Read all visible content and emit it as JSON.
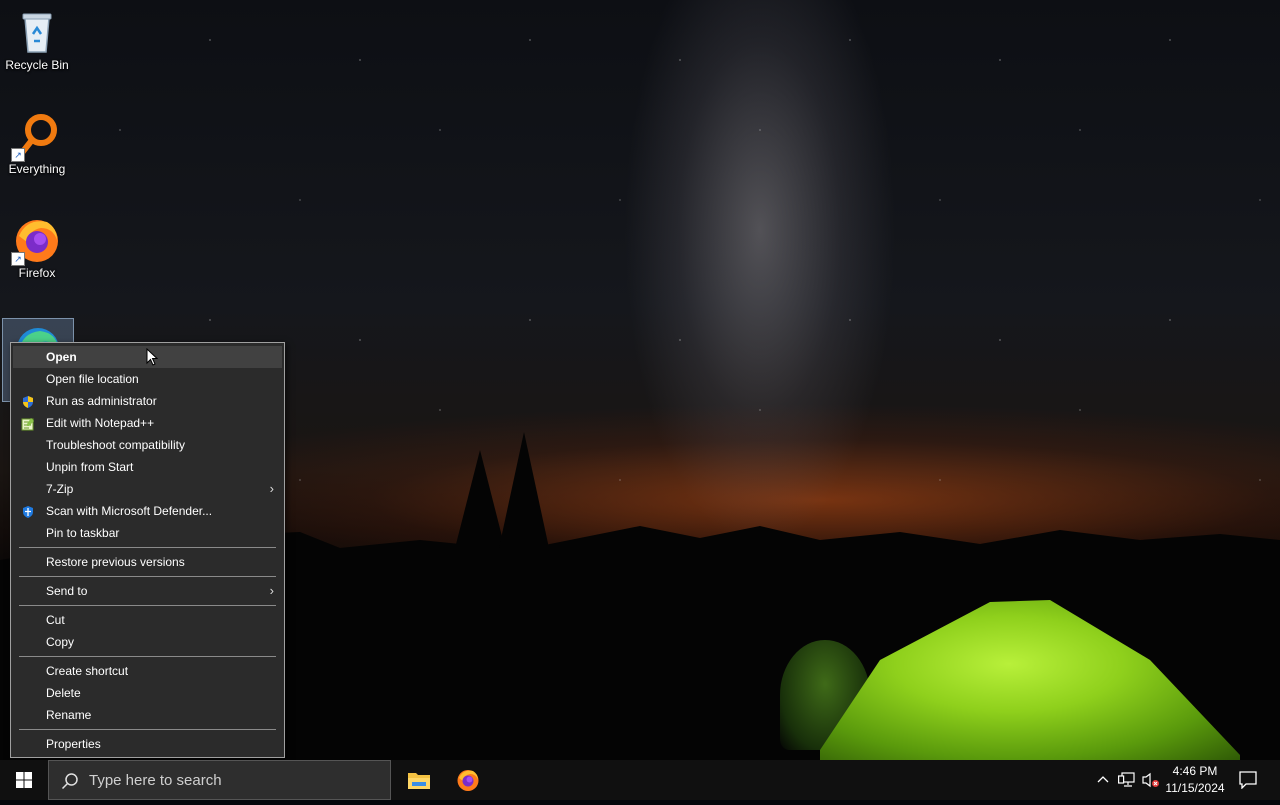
{
  "desktop": {
    "icons": [
      {
        "label": "Recycle Bin",
        "icon": "recycle-bin-icon"
      },
      {
        "label": "Everything",
        "icon": "everything-search-icon"
      },
      {
        "label": "Firefox",
        "icon": "firefox-icon"
      },
      {
        "label": "",
        "icon": "edge-icon"
      }
    ]
  },
  "context_menu": {
    "items": [
      {
        "label": "Open",
        "bold": true
      },
      {
        "label": "Open file location"
      },
      {
        "label": "Run as administrator",
        "icon": "uac-shield-icon"
      },
      {
        "label": "Edit with Notepad++",
        "icon": "notepadpp-icon"
      },
      {
        "label": "Troubleshoot compatibility"
      },
      {
        "label": "Unpin from Start"
      },
      {
        "label": "7-Zip",
        "submenu": true
      },
      {
        "label": "Scan with Microsoft Defender...",
        "icon": "defender-icon"
      },
      {
        "label": "Pin to taskbar"
      },
      {
        "label": "Restore previous versions"
      },
      {
        "label": "Send to",
        "submenu": true
      },
      {
        "label": "Cut"
      },
      {
        "label": "Copy"
      },
      {
        "label": "Create shortcut"
      },
      {
        "label": "Delete"
      },
      {
        "label": "Rename"
      },
      {
        "label": "Properties"
      }
    ]
  },
  "taskbar": {
    "search_placeholder": "Type here to search",
    "pinned": [
      "file-explorer-icon",
      "firefox-icon"
    ],
    "tray_icons": [
      "chevron-up-icon",
      "network-icon",
      "volume-muted-icon"
    ],
    "clock": {
      "time": "4:46 PM",
      "date": "11/15/2024"
    },
    "notification_icon": "notification-icon"
  },
  "colors": {
    "menu_bg": "#2b2b2b",
    "menu_hover": "#414141",
    "taskbar_bg": "#101010",
    "search_bg": "#2e2e2e"
  }
}
